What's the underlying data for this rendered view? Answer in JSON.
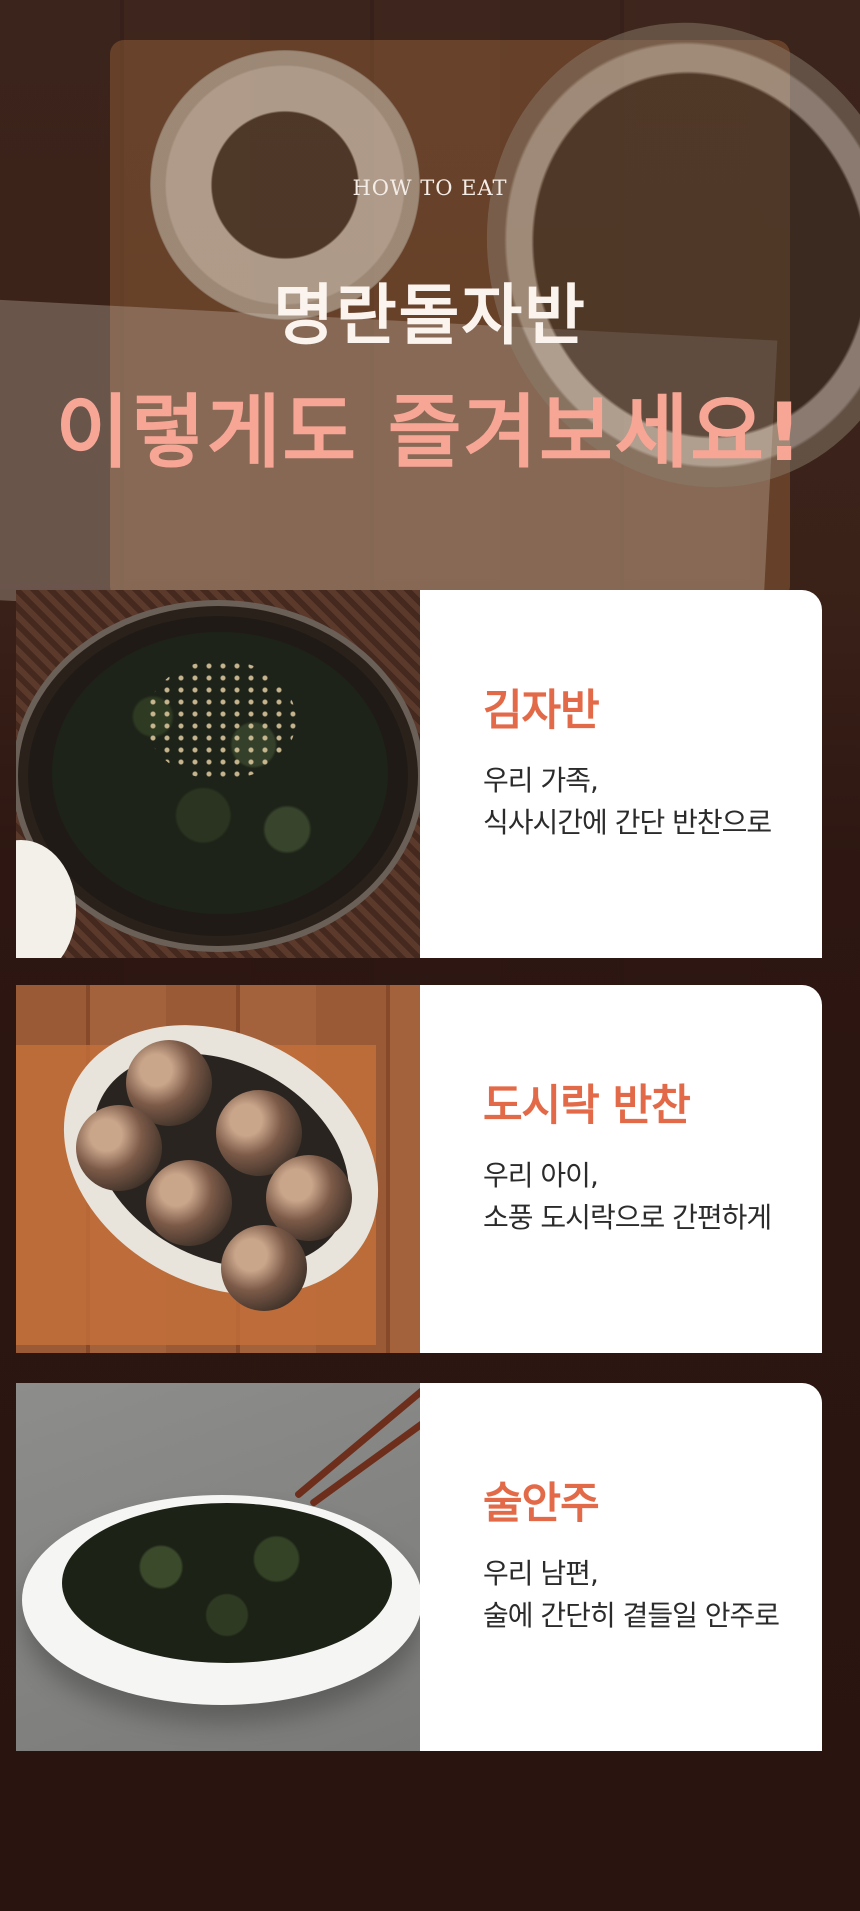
{
  "header": {
    "eyebrow": "HOW TO EAT",
    "title_line1": "명란돌자반",
    "title_line2": "이렇게도 즐겨보세요!"
  },
  "cards": [
    {
      "name": "김자반",
      "desc_line1": "우리 가족,",
      "desc_line2": "식사시간에 간단 반찬으로"
    },
    {
      "name": "도시락 반찬",
      "desc_line1": "우리 아이,",
      "desc_line2": "소풍 도시락으로 간편하게"
    },
    {
      "name": "술안주",
      "desc_line1": "우리 남편,",
      "desc_line2": "술에 간단히 곁들일 안주로"
    }
  ],
  "colors": {
    "title_accent": "#f7a696",
    "card_title": "#e36a48",
    "background": "#2a1612"
  }
}
